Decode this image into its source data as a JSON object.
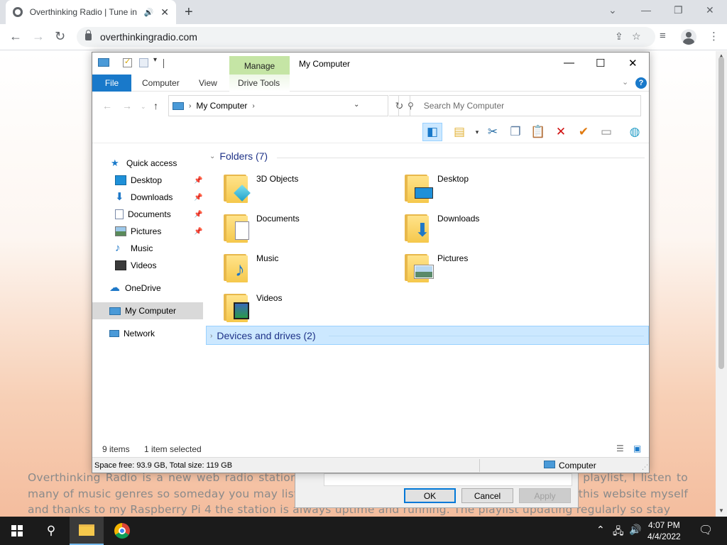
{
  "browser": {
    "tab_title": "Overthinking Radio | Tune in",
    "url": "overthinkingradio.com"
  },
  "page": {
    "paragraph": "Overthinking Radio is a new web radio station that plays my music, everything on it is on my playlist, I listen to many of music genres so someday you may listen to something you never heard before. I made this website myself and thanks to my Raspberry Pi 4 the station is always uptime and running. The playlist updating regularly so stay"
  },
  "dialog": {
    "ok": "OK",
    "cancel": "Cancel",
    "apply": "Apply"
  },
  "explorer": {
    "title": "My Computer",
    "manage_tab": "Manage",
    "ribbon_tabs": {
      "file": "File",
      "computer": "Computer",
      "view": "View",
      "drive_tools": "Drive Tools"
    },
    "address": "My Computer",
    "search_placeholder": "Search My Computer",
    "nav": {
      "quick_access": "Quick access",
      "desktop": "Desktop",
      "downloads": "Downloads",
      "documents": "Documents",
      "pictures": "Pictures",
      "music": "Music",
      "videos": "Videos",
      "onedrive": "OneDrive",
      "my_computer": "My Computer",
      "network": "Network"
    },
    "folders_header": "Folders (7)",
    "devices_header": "Devices and drives (2)",
    "folders": {
      "objects3d": "3D Objects",
      "desktop": "Desktop",
      "documents": "Documents",
      "downloads": "Downloads",
      "music": "Music",
      "pictures": "Pictures",
      "videos": "Videos"
    },
    "status": {
      "items": "9 items",
      "selected": "1 item selected"
    },
    "info": {
      "space": "Space free: 93.9 GB, Total size: 119 GB",
      "location": "Computer"
    }
  },
  "taskbar": {
    "time": "4:07 PM",
    "date": "4/4/2022"
  },
  "colors": {
    "accent": "#1979ca",
    "manage_tab": "#c5e5a5",
    "selection": "#cce8ff"
  }
}
